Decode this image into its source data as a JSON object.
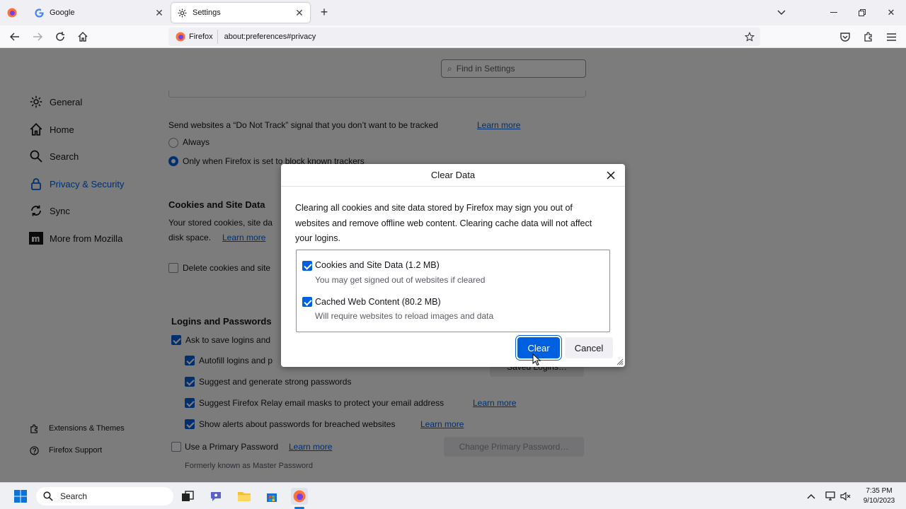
{
  "browser": {
    "tabs": [
      {
        "label": "Google",
        "icon": "google-icon",
        "active": false
      },
      {
        "label": "Settings",
        "icon": "gear-icon",
        "active": true
      }
    ],
    "identity_label": "Firefox",
    "url": "about:preferences#privacy"
  },
  "settings": {
    "search_placeholder": "Find in Settings",
    "nav": [
      {
        "label": "General",
        "icon": "gear-icon"
      },
      {
        "label": "Home",
        "icon": "home-icon"
      },
      {
        "label": "Search",
        "icon": "search-icon"
      },
      {
        "label": "Privacy & Security",
        "icon": "lock-icon",
        "selected": true
      },
      {
        "label": "Sync",
        "icon": "sync-icon"
      },
      {
        "label": "More from Mozilla",
        "icon": "mozilla-icon"
      }
    ],
    "footer_nav": [
      {
        "label": "Extensions & Themes",
        "icon": "puzzle-icon"
      },
      {
        "label": "Firefox Support",
        "icon": "help-icon"
      }
    ],
    "dnt": {
      "text": "Send websites a “Do Not Track” signal that you don’t want to be tracked",
      "learn_more": "Learn more",
      "options": [
        "Always",
        "Only when Firefox is set to block known trackers"
      ]
    },
    "cookies": {
      "heading": "Cookies and Site Data",
      "desc_line1": "Your stored cookies, site da",
      "desc_line2": "disk space.",
      "learn_more": "Learn more",
      "delete_label": "Delete cookies and site"
    },
    "logins": {
      "heading": "Logins and Passwords",
      "ask_save": "Ask to save logins and",
      "autofill": "Autofill logins and p",
      "saved_logins_button": "Saved Logins…",
      "suggest": "Suggest and generate strong passwords",
      "relay": "Suggest Firefox Relay email masks to protect your email address",
      "relay_learn_more": "Learn more",
      "breach": "Show alerts about passwords for breached websites",
      "breach_learn_more": "Learn more",
      "primary": "Use a Primary Password",
      "primary_learn_more": "Learn more",
      "change_primary_button": "Change Primary Password…",
      "formerly": "Formerly known as Master Password"
    }
  },
  "dialog": {
    "title": "Clear Data",
    "description": "Clearing all cookies and site data stored by Firefox may sign you out of websites and remove offline web content. Clearing cache data will not affect your logins.",
    "options": [
      {
        "label": "Cookies and Site Data (1.2 MB)",
        "sub": "You may get signed out of websites if cleared",
        "checked": true
      },
      {
        "label": "Cached Web Content (80.2 MB)",
        "sub": "Will require websites to reload images and data",
        "checked": true
      }
    ],
    "clear_label": "Clear",
    "cancel_label": "Cancel"
  },
  "taskbar": {
    "search_label": "Search",
    "time": "7:35 PM",
    "date": "9/10/2023"
  },
  "colors": {
    "accent": "#0061e0",
    "overlay": "rgba(0,0,0,0.5)"
  }
}
